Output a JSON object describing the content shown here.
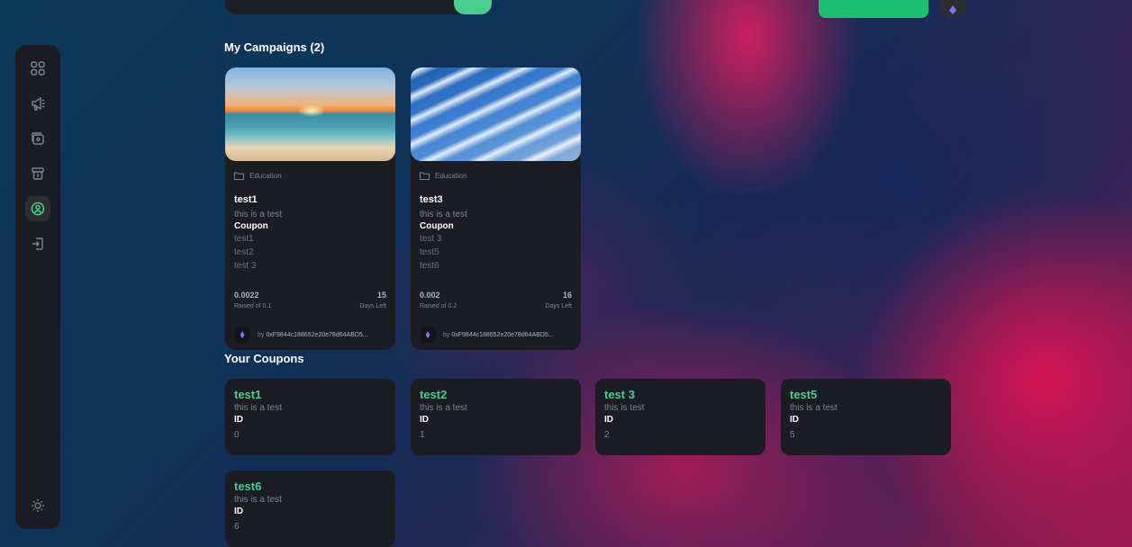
{
  "header": {
    "search_value": "",
    "create_button_label": ""
  },
  "sidebar": {
    "items": [
      {
        "icon": "dashboard-icon"
      },
      {
        "icon": "megaphone-icon"
      },
      {
        "icon": "payment-icon"
      },
      {
        "icon": "withdraw-icon"
      },
      {
        "icon": "profile-icon",
        "active": true
      },
      {
        "icon": "logout-icon"
      }
    ],
    "theme_icon": "sun-icon"
  },
  "my_campaigns": {
    "title": "My Campaigns (2)",
    "cards": [
      {
        "category": "Education",
        "title": "test1",
        "description": "this is a test",
        "coupon_label": "Coupon",
        "coupons": [
          "test1",
          "test2",
          "test 3"
        ],
        "raised": "0.0022",
        "raised_label": "Raised of 0.1",
        "days": "15",
        "days_label": "Days Left",
        "by_label": "by",
        "owner": "0xF9844c188652e20e78d64ABD5..."
      },
      {
        "category": "Education",
        "title": "test3",
        "description": "this is a test",
        "coupon_label": "Coupon",
        "coupons": [
          "test 3",
          "test5",
          "test6"
        ],
        "raised": "0.002",
        "raised_label": "Raised of 0.2",
        "days": "16",
        "days_label": "Days Left",
        "by_label": "by",
        "owner": "0xF9844c188652e20e78d64ABD5..."
      }
    ]
  },
  "your_coupons": {
    "title": "Your Coupons",
    "cards": [
      {
        "name": "test1",
        "description": "this is a test",
        "id_label": "ID",
        "id": "0"
      },
      {
        "name": "test2",
        "description": "this is a test",
        "id_label": "ID",
        "id": "1"
      },
      {
        "name": "test 3",
        "description": "this is test",
        "id_label": "ID",
        "id": "2"
      },
      {
        "name": "test5",
        "description": "this is a test",
        "id_label": "ID",
        "id": "5"
      },
      {
        "name": "test6",
        "description": "this is a test",
        "id_label": "ID",
        "id": "6"
      }
    ]
  },
  "colors": {
    "accent": "#4acd8d",
    "card": "#1c1c24",
    "muted": "#808191"
  }
}
